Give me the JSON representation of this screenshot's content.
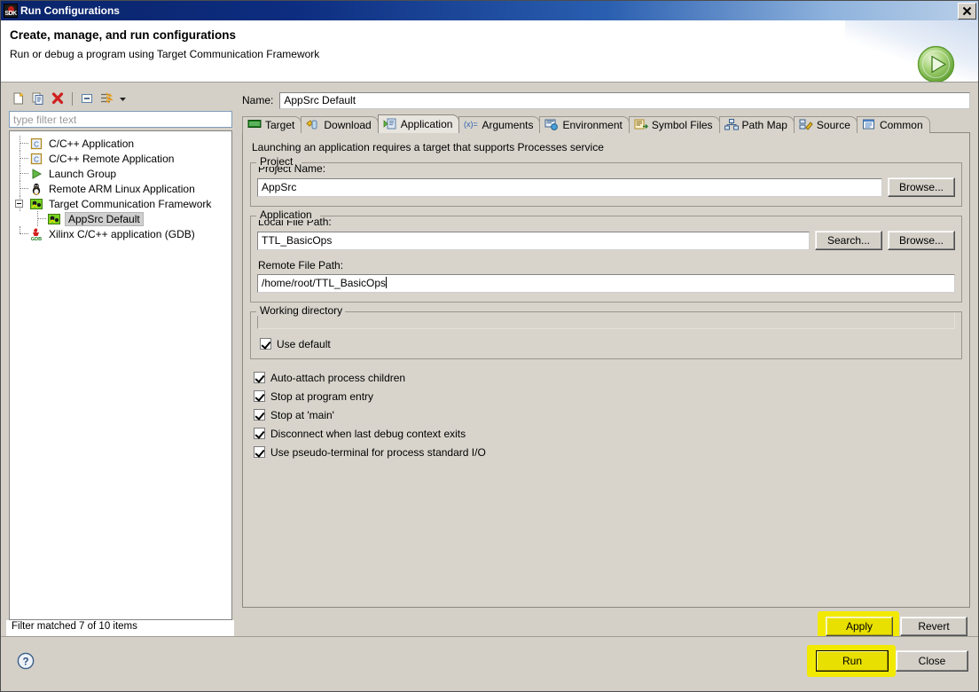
{
  "window": {
    "title": "Run Configurations",
    "title_icon": "sdk-icon",
    "close_label": "✕"
  },
  "header": {
    "title": "Create, manage, and run configurations",
    "subtitle": "Run or debug a program using Target Communication Framework",
    "icon": "run-green-arrow-icon"
  },
  "tree_toolbar": {
    "buttons": [
      {
        "name": "new-launch-configuration-button",
        "icon": "new-document-icon"
      },
      {
        "name": "duplicate-launch-configuration-button",
        "icon": "copy-icon"
      },
      {
        "name": "delete-launch-configuration-button",
        "icon": "delete-red-x-icon"
      },
      {
        "name": "collapse-all-button",
        "icon": "collapse-all-icon"
      },
      {
        "name": "filter-button",
        "icon": "filter-icon"
      },
      {
        "name": "filter-dropdown-button",
        "icon": "chevron-down-icon"
      }
    ]
  },
  "filter": {
    "placeholder": "type filter text",
    "value": "",
    "status": "Filter matched 7 of 10 items"
  },
  "tree": {
    "items": [
      {
        "label": "C/C++ Application",
        "icon": "c-app-icon",
        "depth": 1,
        "selected": false,
        "expander": false
      },
      {
        "label": "C/C++ Remote Application",
        "icon": "c-app-icon",
        "depth": 1,
        "selected": false,
        "expander": false
      },
      {
        "label": "Launch Group",
        "icon": "launch-group-green-arrow-icon",
        "depth": 1,
        "selected": false,
        "expander": false
      },
      {
        "label": "Remote ARM Linux Application",
        "icon": "linux-penguin-icon",
        "depth": 1,
        "selected": false,
        "expander": false
      },
      {
        "label": "Target Communication Framework",
        "icon": "tcf-icon",
        "depth": 1,
        "selected": false,
        "expander": true
      },
      {
        "label": "AppSrc Default",
        "icon": "tcf-icon",
        "depth": 2,
        "selected": true,
        "expander": false
      },
      {
        "label": "Xilinx C/C++ application (GDB)",
        "icon": "gdb-icon",
        "depth": 1,
        "selected": false,
        "expander": false
      }
    ]
  },
  "name_field": {
    "label": "Name:",
    "value": "AppSrc Default"
  },
  "tabs": [
    {
      "label": "Target",
      "icon": "target-chip-icon",
      "active": false
    },
    {
      "label": "Download",
      "icon": "download-icon",
      "active": false
    },
    {
      "label": "Application",
      "icon": "application-icon",
      "active": true
    },
    {
      "label": "Arguments",
      "icon": "arguments-icon",
      "active": false
    },
    {
      "label": "Environment",
      "icon": "environment-icon",
      "active": false
    },
    {
      "label": "Symbol Files",
      "icon": "symbol-files-icon",
      "active": false
    },
    {
      "label": "Path Map",
      "icon": "path-map-icon",
      "active": false
    },
    {
      "label": "Source",
      "icon": "source-icon",
      "active": false
    },
    {
      "label": "Common",
      "icon": "common-icon",
      "active": false
    }
  ],
  "application_tab": {
    "description": "Launching an application requires a target that supports Processes service",
    "project_group": {
      "title": "Project",
      "project_name_label": "Project Name:",
      "project_name_value": "AppSrc",
      "browse_label": "Browse..."
    },
    "application_group": {
      "title": "Application",
      "local_file_path_label": "Local File Path:",
      "local_file_path_value": "TTL_BasicOps",
      "search_label": "Search...",
      "browse_label": "Browse...",
      "remote_file_path_label": "Remote File Path:",
      "remote_file_path_value": "/home/root/TTL_BasicOps"
    },
    "working_directory_group": {
      "title": "Working directory",
      "path_value": "",
      "use_default_label": "Use default",
      "use_default_checked": true
    },
    "options": [
      {
        "label": "Auto-attach process children",
        "checked": true
      },
      {
        "label": "Stop at program entry",
        "checked": true
      },
      {
        "label": "Stop at 'main'",
        "checked": true
      },
      {
        "label": "Disconnect when last debug context exits",
        "checked": true
      },
      {
        "label": "Use pseudo-terminal for process standard I/O",
        "checked": true
      }
    ]
  },
  "panel_buttons": {
    "apply_label": "Apply",
    "revert_label": "Revert",
    "apply_highlighted": true
  },
  "footer": {
    "help_icon": "help-question-icon",
    "run_label": "Run",
    "close_label": "Close",
    "run_highlighted": true
  },
  "colors": {
    "title_bar_start": "#0a246a",
    "title_bar_end": "#b9cfe8",
    "dialog_bg": "#d4d0c8",
    "tab_panel_bg": "#d8d4cc",
    "highlight_yellow": "#f2e900",
    "accent_green": "#6cb33f",
    "selection_gray": "#d0d0d0"
  }
}
